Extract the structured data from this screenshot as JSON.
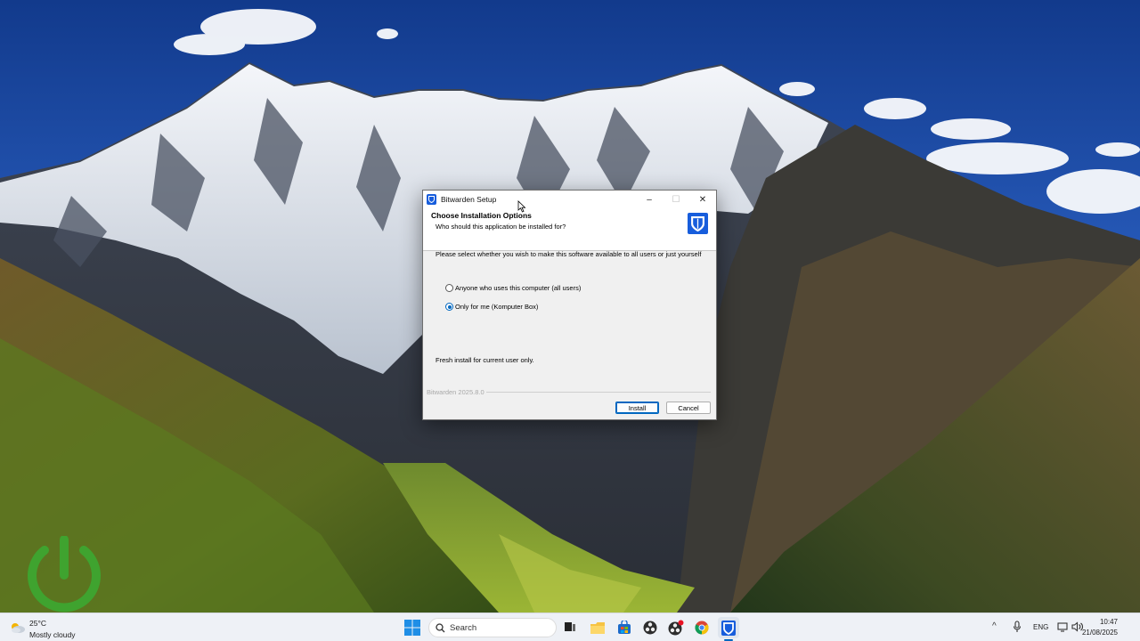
{
  "desktop": {
    "wallpaper": "snowy-mountain-valley",
    "overlay_logo": "green-power-icon"
  },
  "dialog": {
    "title": "Bitwarden Setup",
    "header_title": "Choose Installation Options",
    "header_subtitle": "Who should this application be installed for?",
    "instruction": "Please select whether you wish to make this software available to all users or just yourself",
    "options": [
      {
        "label": "Anyone who uses this computer (all users)",
        "selected": false
      },
      {
        "label": "Only for me (Komputer Box)",
        "selected": true
      }
    ],
    "status_text": "Fresh install for current user only.",
    "branding": "Bitwarden 2025.8.0",
    "install_label": "Install",
    "cancel_label": "Cancel",
    "window_controls": {
      "minimize": "–",
      "maximize": "☐",
      "close": "✕"
    },
    "accent_color": "#175ddc"
  },
  "taskbar": {
    "weather": {
      "temp": "25°C",
      "description": "Mostly cloudy"
    },
    "search_placeholder": "Search",
    "apps": [
      "task-view",
      "file-explorer",
      "microsoft-store",
      "obs-studio",
      "obs-studio-2",
      "chrome",
      "bitwarden"
    ],
    "tray": {
      "language": "ENG",
      "chevron": "^"
    },
    "clock": {
      "time": "10:47",
      "date": "21/08/2025"
    }
  }
}
